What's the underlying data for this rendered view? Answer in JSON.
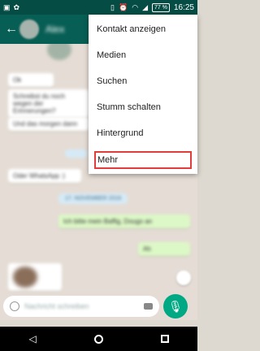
{
  "status_bar": {
    "battery_text": "77 %",
    "clock": "16:25"
  },
  "app_bar": {
    "back_icon": "arrow-left-icon",
    "contact_name": "Alex"
  },
  "chat": {
    "messages": [
      {
        "text": "Ok",
        "direction": "in"
      },
      {
        "text": "Schreibst du noch wegen der Erinnerungen?",
        "direction": "in"
      },
      {
        "text": "Und das morgen dann",
        "direction": "in"
      },
      {
        "text": "Oder WhatsApp :)",
        "direction": "in"
      },
      {
        "text": "Ich bitte mein Baffig, Dougo an",
        "direction": "out"
      },
      {
        "text": "Ah",
        "direction": "out"
      }
    ],
    "date_labels": [
      "17. NOVEMBER 2016"
    ],
    "input_placeholder": "Nachricht schreiben"
  },
  "overflow_menu": {
    "items": [
      {
        "label": "Kontakt anzeigen"
      },
      {
        "label": "Medien"
      },
      {
        "label": "Suchen"
      },
      {
        "label": "Stumm schalten"
      },
      {
        "label": "Hintergrund"
      },
      {
        "label": "Mehr",
        "highlighted": true
      }
    ]
  },
  "colors": {
    "app_bar": "#075e54",
    "status_bar": "#054d44",
    "chat_background": "#e5ddd5",
    "outgoing_bubble": "#dcf8c6",
    "fab": "#00a884",
    "highlight_outline": "#e23c3c"
  }
}
